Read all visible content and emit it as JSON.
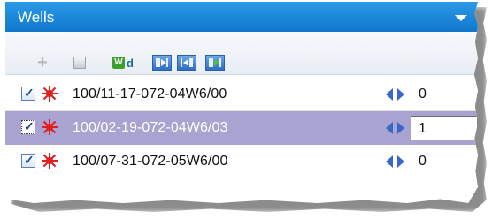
{
  "panel": {
    "title": "Wells",
    "colors": {
      "titlebar": "#1a86d6",
      "selected_row": "#a8a3d0",
      "well_symbol": "#e11d1d"
    }
  },
  "toolbar": {
    "buttons": [
      {
        "icon": "plus-icon"
      },
      {
        "icon": "square-icon"
      },
      {
        "icon": "wd-icon",
        "text_w": "W",
        "text_d": "d"
      },
      {
        "icon": "arrow-right-icon"
      },
      {
        "icon": "arrow-left-icon"
      },
      {
        "icon": "arrow-right-green-icon"
      }
    ]
  },
  "wells": [
    {
      "uwi": "100/11-17-072-04W6/00",
      "checked": true,
      "selected": false,
      "value": "0"
    },
    {
      "uwi": "100/02-19-072-04W6/03",
      "checked": true,
      "selected": true,
      "value": "1"
    },
    {
      "uwi": "100/07-31-072-05W6/00",
      "checked": true,
      "selected": false,
      "value": "0"
    }
  ]
}
